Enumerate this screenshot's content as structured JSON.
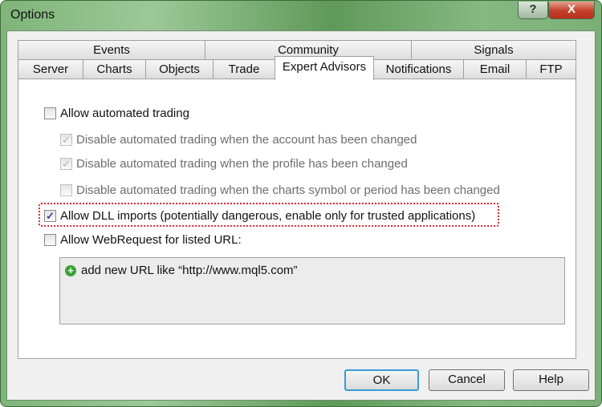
{
  "window": {
    "title": "Options",
    "help_label": "?",
    "close_label": "X"
  },
  "tabs": {
    "row1": [
      "Events",
      "Community",
      "Signals"
    ],
    "row2": [
      "Server",
      "Charts",
      "Objects",
      "Trade",
      "Expert Advisors",
      "Notifications",
      "Email",
      "FTP"
    ],
    "selected": "Expert Advisors"
  },
  "options": [
    {
      "label": "Allow automated trading",
      "checked": false,
      "enabled": true
    },
    {
      "label": "Disable automated trading when the account has been changed",
      "checked": true,
      "enabled": false
    },
    {
      "label": "Disable automated trading when the profile has been changed",
      "checked": true,
      "enabled": false
    },
    {
      "label": "Disable automated trading when the charts symbol or period has been changed",
      "checked": false,
      "enabled": false
    },
    {
      "label": "Allow DLL imports (potentially dangerous, enable only for trusted applications)",
      "checked": true,
      "enabled": true,
      "focused": true
    },
    {
      "label": "Allow WebRequest for listed URL:",
      "checked": false,
      "enabled": true
    }
  ],
  "url_list": {
    "add_label": "add new URL like “http://www.mql5.com”",
    "icon": "plus-circle-icon"
  },
  "buttons": {
    "ok": "OK",
    "cancel": "Cancel",
    "help": "Help"
  },
  "colors": {
    "frame": "#7fb47a",
    "focus_outline": "#e0262a",
    "default_button": "#3c9ad8"
  }
}
